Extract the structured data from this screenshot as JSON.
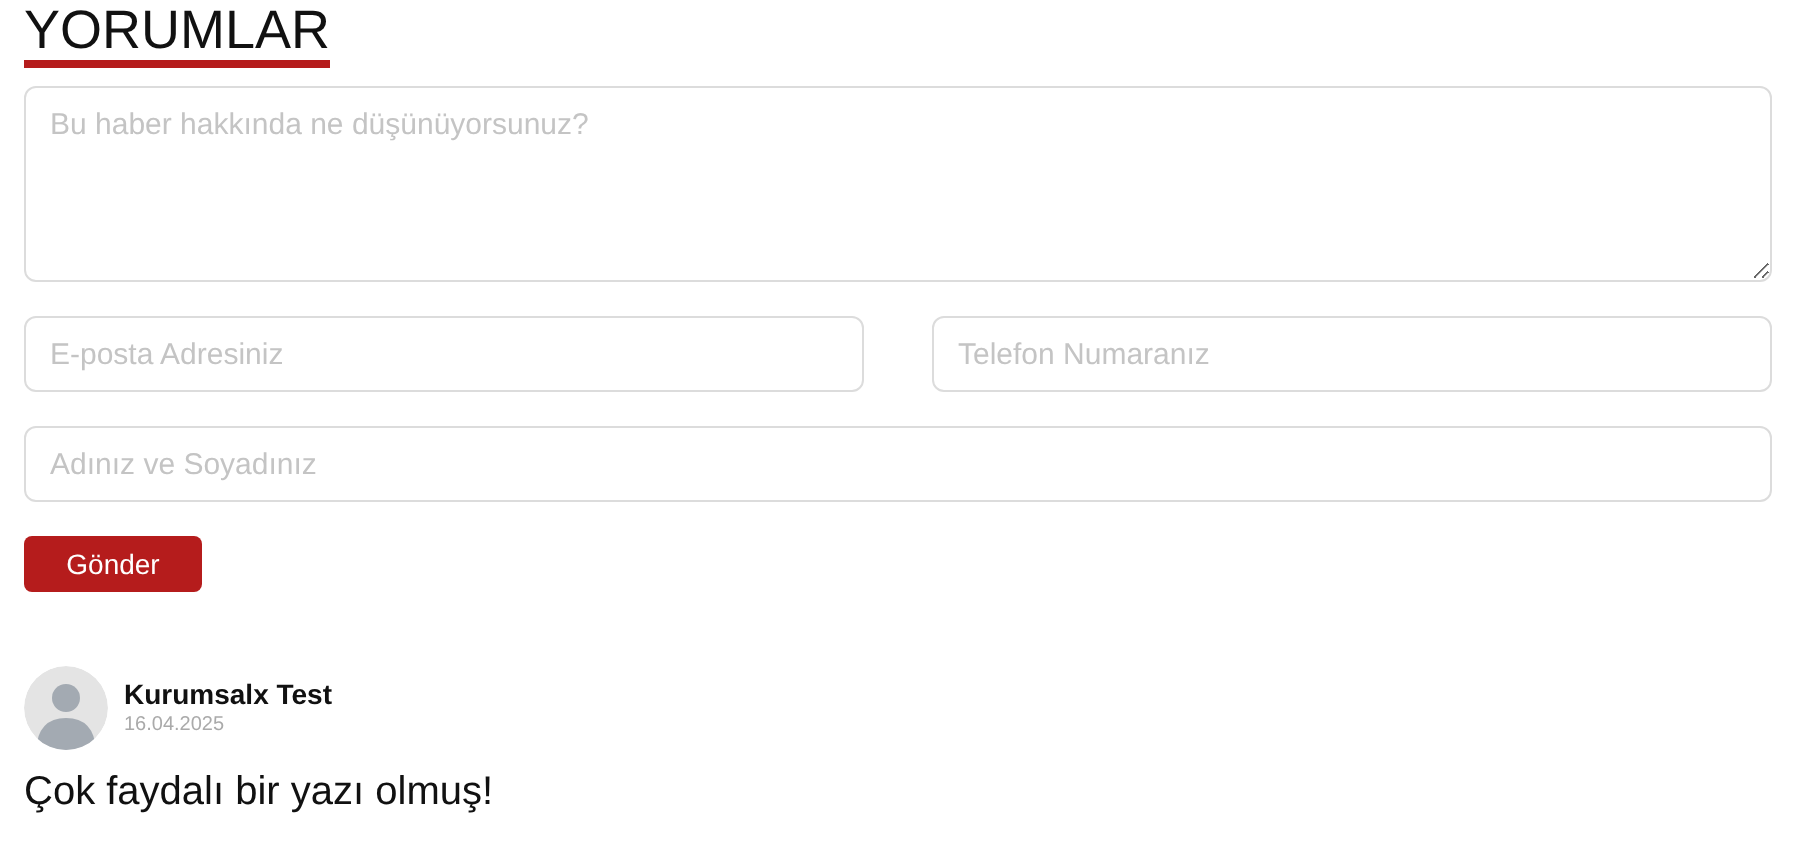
{
  "heading": "YORUMLAR",
  "form": {
    "message": {
      "placeholder": "Bu haber hakkında ne düşünüyorsunuz?"
    },
    "email": {
      "placeholder": "E-posta Adresiniz"
    },
    "phone": {
      "placeholder": "Telefon Numaranız"
    },
    "name": {
      "placeholder": "Adınız ve Soyadınız"
    },
    "submit": "Gönder"
  },
  "comments": [
    {
      "author": "Kurumsalx Test",
      "date": "16.04.2025",
      "text": "Çok faydalı bir yazı olmuş!"
    }
  ]
}
